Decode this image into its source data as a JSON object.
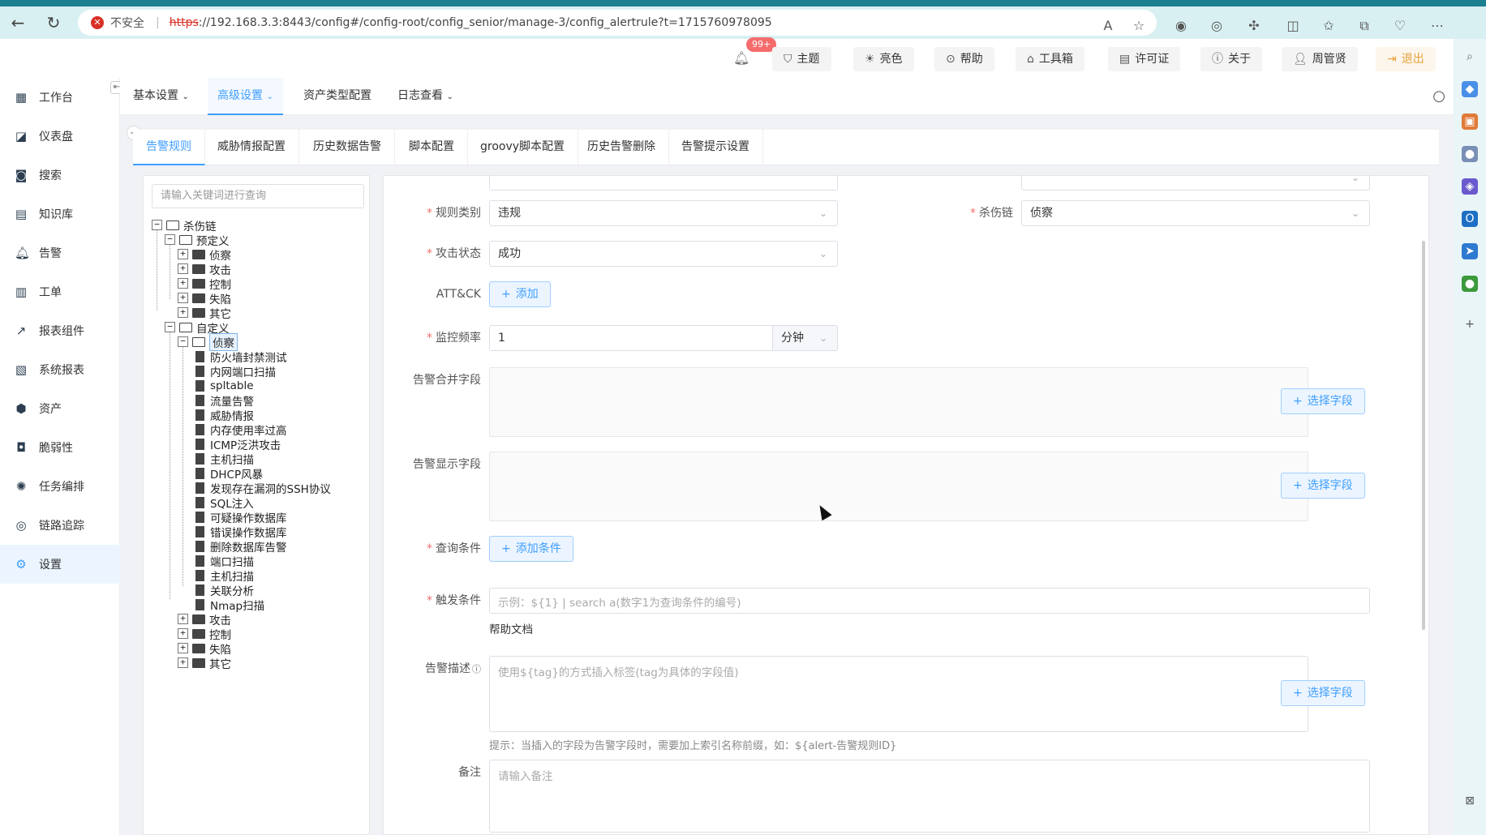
{
  "browser": {
    "insecure_label": "不安全",
    "url_scheme": "https",
    "url_rest": "://192.168.3.3:8443/config#/config-root/config_senior/manage-3/config_alertrule?t=1715760978095"
  },
  "header": {
    "notification_count": "99+",
    "theme": "主题",
    "light": "亮色",
    "help": "帮助",
    "toolbox": "工具箱",
    "license": "许可证",
    "about": "关于",
    "user": "周管贤",
    "logout": "退出"
  },
  "sidebar": {
    "items": [
      {
        "label": "工作台",
        "icon": "workbench-icon"
      },
      {
        "label": "仪表盘",
        "icon": "dashboard-icon"
      },
      {
        "label": "搜索",
        "icon": "search-icon"
      },
      {
        "label": "知识库",
        "icon": "knowledge-icon"
      },
      {
        "label": "告警",
        "icon": "alarm-icon"
      },
      {
        "label": "工单",
        "icon": "ticket-icon"
      },
      {
        "label": "报表组件",
        "icon": "report-component-icon"
      },
      {
        "label": "系统报表",
        "icon": "system-report-icon"
      },
      {
        "label": "资产",
        "icon": "asset-icon"
      },
      {
        "label": "脆弱性",
        "icon": "vulnerability-icon"
      },
      {
        "label": "任务编排",
        "icon": "task-orchestration-icon"
      },
      {
        "label": "链路追踪",
        "icon": "trace-icon"
      },
      {
        "label": "设置",
        "icon": "gear-icon"
      }
    ]
  },
  "top_menu": {
    "items": [
      "基本设置",
      "高级设置",
      "资产类型配置",
      "日志查看"
    ]
  },
  "sub_tabs": [
    "告警规则",
    "威胁情报配置",
    "历史数据告警",
    "脚本配置",
    "groovy脚本配置",
    "历史告警删除",
    "告警提示设置"
  ],
  "tree": {
    "search_placeholder": "请输入关键词进行查询",
    "root": "杀伤链",
    "predefined": "预定义",
    "predefined_children": [
      "侦察",
      "攻击",
      "控制",
      "失陷",
      "其它"
    ],
    "custom": "自定义",
    "custom_recon": "侦察",
    "recon_children": [
      "防火墙封禁测试",
      "内网端口扫描",
      "spltable",
      "流量告警",
      "威胁情报",
      "内存使用率过高",
      "ICMP泛洪攻击",
      "主机扫描",
      "DHCP风暴",
      "发现存在漏洞的SSH协议",
      "SQL注入",
      "可疑操作数据库",
      "错误操作数据库",
      "删除数据库告警",
      "端口扫描",
      "主机扫描",
      "关联分析",
      "Nmap扫描"
    ],
    "custom_children": [
      "攻击",
      "控制",
      "失陷",
      "其它"
    ]
  },
  "form": {
    "rule_category_label": "规则类别",
    "rule_category_value": "违规",
    "kill_chain_label": "杀伤链",
    "kill_chain_value": "侦察",
    "attack_status_label": "攻击状态",
    "attack_status_value": "成功",
    "attck_label": "ATT&CK",
    "add_label": "添加",
    "monitor_freq_label": "监控频率",
    "monitor_freq_value": "1",
    "monitor_freq_unit": "分钟",
    "merge_fields_label": "告警合并字段",
    "display_fields_label": "告警显示字段",
    "select_field_label": "选择字段",
    "query_cond_label": "查询条件",
    "add_cond_label": "添加条件",
    "trigger_label": "触发条件",
    "trigger_placeholder": "示例：${1} | search a(数字1为查询条件的编号)",
    "help_doc": "帮助文档",
    "desc_label": "告警描述",
    "desc_placeholder": "使用${tag}的方式插入标签(tag为具体的字段值)",
    "desc_hint": "提示：当插入的字段为告警字段时，需要加上索引名称前缀，如：${alert-告警规则ID}",
    "remark_label": "备注",
    "remark_placeholder": "请输入备注"
  }
}
